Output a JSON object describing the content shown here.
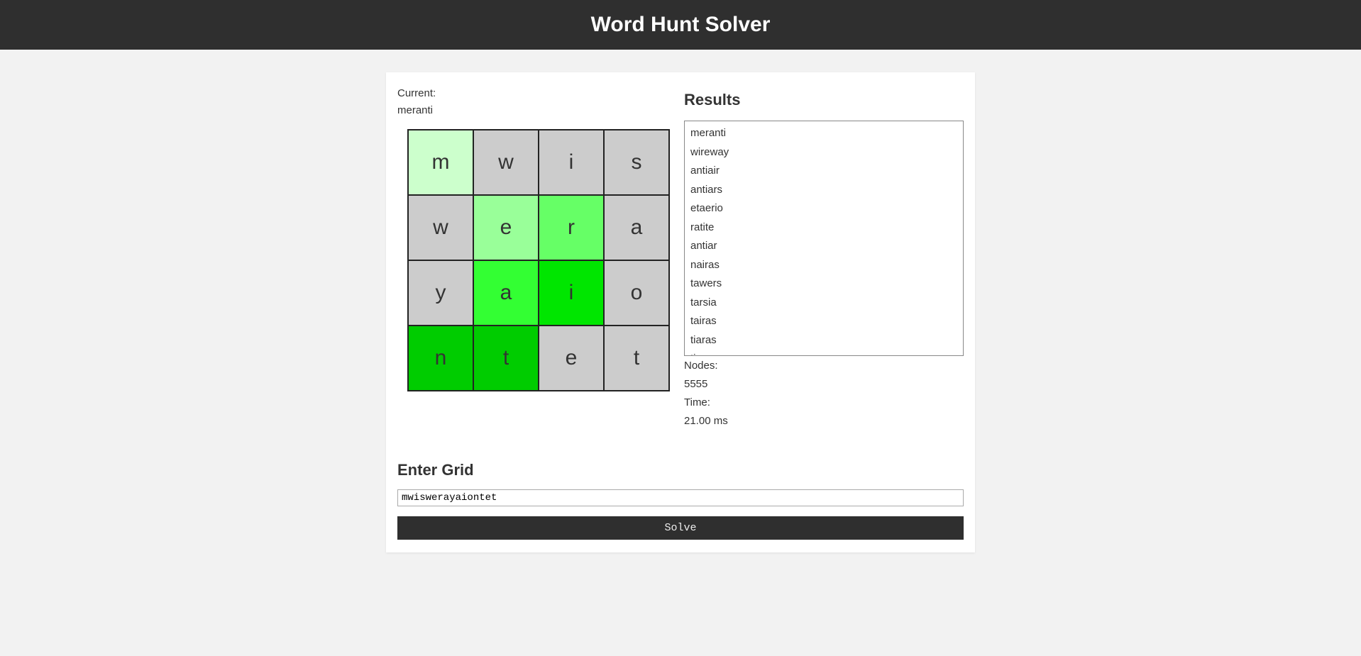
{
  "header": {
    "title": "Word Hunt Solver"
  },
  "current": {
    "label": "Current:",
    "word": "meranti"
  },
  "grid": {
    "size": 4,
    "cells": [
      {
        "letter": "m",
        "highlight": 1
      },
      {
        "letter": "w",
        "highlight": 0
      },
      {
        "letter": "i",
        "highlight": 0
      },
      {
        "letter": "s",
        "highlight": 0
      },
      {
        "letter": "w",
        "highlight": 0
      },
      {
        "letter": "e",
        "highlight": 2
      },
      {
        "letter": "r",
        "highlight": 3
      },
      {
        "letter": "a",
        "highlight": 0
      },
      {
        "letter": "y",
        "highlight": 0
      },
      {
        "letter": "a",
        "highlight": 4
      },
      {
        "letter": "i",
        "highlight": 5
      },
      {
        "letter": "o",
        "highlight": 0
      },
      {
        "letter": "n",
        "highlight": 6
      },
      {
        "letter": "t",
        "highlight": 7
      },
      {
        "letter": "e",
        "highlight": 0
      },
      {
        "letter": "t",
        "highlight": 0
      }
    ]
  },
  "results": {
    "heading": "Results",
    "items": [
      "meranti",
      "wireway",
      "antiair",
      "antiars",
      "etaerio",
      "ratite",
      "antiar",
      "nairas",
      "tawers",
      "tarsia",
      "tairas",
      "tiaras",
      "tiaras"
    ],
    "nodes_label": "Nodes:",
    "nodes_value": "5555",
    "time_label": "Time:",
    "time_value": "21.00 ms"
  },
  "entry": {
    "heading": "Enter Grid",
    "input_value": "mwiswerayaiontet",
    "solve_label": "Solve"
  }
}
